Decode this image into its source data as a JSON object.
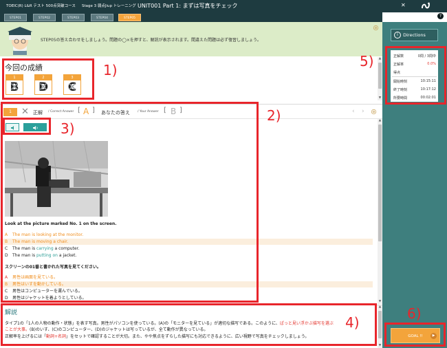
{
  "header": {
    "course": "TOEIC(R) L&R テスト 500点突破コース",
    "stage": "Stage 3 弱点Jiup トレーニング",
    "unit": "UNIT001 Part 1: まずは写真をチェック",
    "close": "✕"
  },
  "tabs": [
    "STEP01",
    "STEP02",
    "STEP03",
    "STEP04",
    "STEP05"
  ],
  "instruction": "STEP05の答え合わせをしましょう。問題の◯×を押すと、解説が表示されます。間違えた問題は必ず復習しましょう。",
  "score": {
    "title": "今回の成績",
    "cards": [
      {
        "num": "1",
        "answer": "B"
      },
      {
        "num": "2",
        "answer": "D"
      },
      {
        "num": "3",
        "answer": "C"
      }
    ]
  },
  "answer_header": {
    "qnum": "1",
    "correct_label": "正解",
    "correct_sub": "/ Correct Answer",
    "correct_answer": "A",
    "your_label": "あなたの答え",
    "your_sub": "/ Your Answer",
    "your_answer": "B"
  },
  "question": {
    "prompt_en": "Look at the picture marked No. 1 on the screen.",
    "options_en": [
      {
        "letter": "A",
        "pre": "The man is ",
        "word": "looking at the monitor",
        "post": "."
      },
      {
        "letter": "B",
        "pre": "The man is ",
        "word": "moving a chair",
        "post": "."
      },
      {
        "letter": "C",
        "pre": "The man is ",
        "word": "carrying",
        "post": " a computer."
      },
      {
        "letter": "D",
        "pre": "The man is ",
        "word": "putting on",
        "post": " a jacket."
      }
    ],
    "prompt_ja": "スクリーンの01番と書かれた写真を見てください。",
    "options_ja": [
      {
        "letter": "A",
        "text": "男性は画面を見ている。"
      },
      {
        "letter": "B",
        "text": "男性はいすを動かしている。"
      },
      {
        "letter": "C",
        "text": "男性はコンピューターを運んでいる。"
      },
      {
        "letter": "D",
        "text": "男性はジャケットを着ようとしている。"
      }
    ]
  },
  "explanation": {
    "title": "解説",
    "line1_a": "タイプ1の「1人の人物の動作・状態」を表す写真。男性がパソコンを使っている。(A)の「モニターを見ている」が適切な描写である。このように、",
    "line1_b": "ぱっと見い浮かぶ描写を選ぶ",
    "line2_a": "ことが大事。",
    "line2_b": "(B)のいす、(C)のコンピューター、(D)のジャケットは写っているが、全て動作が異なっている。",
    "line3_a": "正解率を上げるには「",
    "line3_b": "動詞+名詞",
    "line3_c": "」をセットで確認することが大切。また、やや焦点をずらした描写にも対応できるように、広い視野で写真をチェックしましょう。"
  },
  "side": {
    "directions": "Directions",
    "stats": [
      {
        "label": "正解数",
        "value": "0問 / 3問中",
        "red": false
      },
      {
        "label": "正解率",
        "value": "0.0%",
        "red": true
      },
      {
        "label": "得点",
        "value": "",
        "red": false
      },
      {
        "label": "開始時刻",
        "value": "10:15:11",
        "red": false
      },
      {
        "label": "終了時刻",
        "value": "10:17:12",
        "red": false
      },
      {
        "label": "所要時間",
        "value": "00:02:01",
        "red": false
      }
    ],
    "goal_button": "GOAL !!",
    "help": "?"
  },
  "annotations": [
    "1)",
    "2)",
    "3)",
    "4)",
    "5)",
    "6)"
  ],
  "colors": {
    "header_bg": "#1e3b40",
    "accent_orange": "#f3a43b",
    "teal": "#2aa09b",
    "side_panel": "#3e7f7e",
    "annotation_red": "#e8252b",
    "instruction_bg": "#dcecc8"
  }
}
